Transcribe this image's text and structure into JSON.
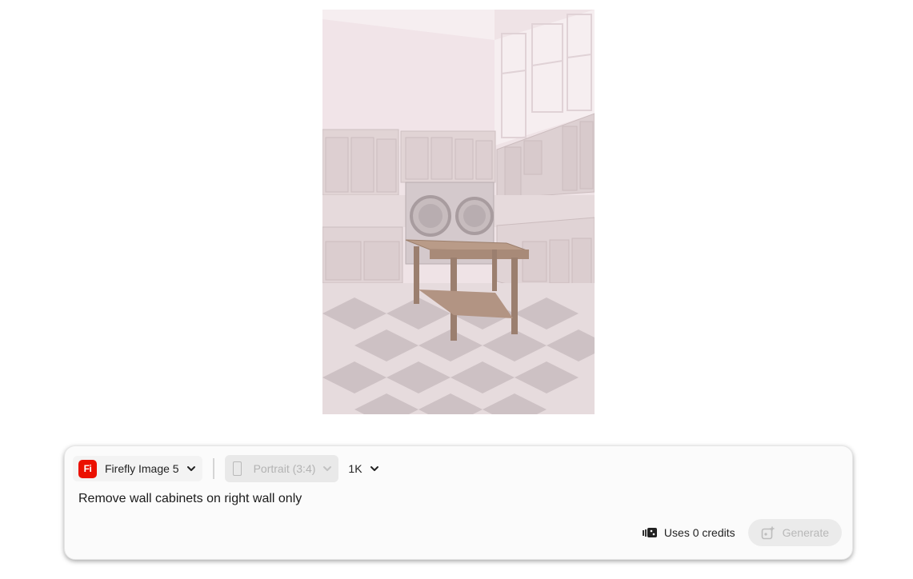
{
  "preview": {
    "alt": "Generated image preview of a laundry room with washer and dryer"
  },
  "toolbar": {
    "model_logo_text": "Fi",
    "model_label": "Firefly Image 5",
    "aspect_label": "Portrait (3:4)",
    "resolution_label": "1K"
  },
  "prompt": {
    "value": "Remove wall cabinets on right wall only"
  },
  "footer": {
    "credits_label": "Uses 0 credits",
    "generate_label": "Generate"
  },
  "colors": {
    "brand": "#eb1000",
    "panel_bg": "#fbfbfb",
    "disabled_text": "#b8b8b8"
  }
}
